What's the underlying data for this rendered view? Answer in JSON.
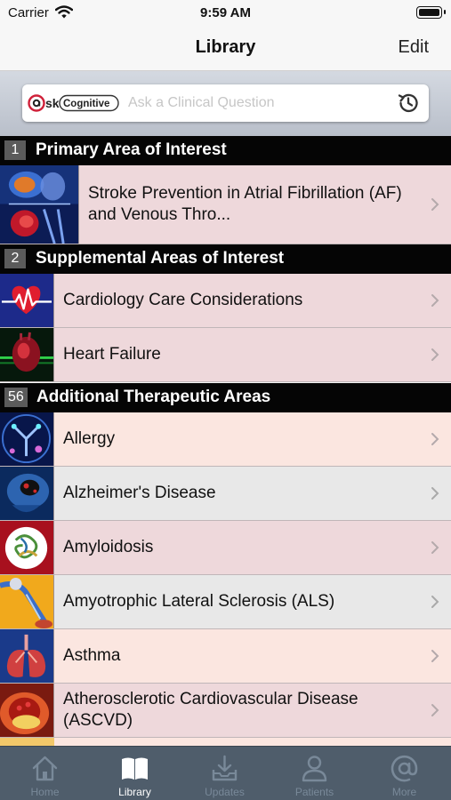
{
  "status_bar": {
    "carrier": "Carrier",
    "time": "9:59 AM"
  },
  "nav": {
    "title": "Library",
    "edit_label": "Edit"
  },
  "search": {
    "logo_text": "ask Cognitive",
    "placeholder": "Ask a Clinical Question",
    "value": ""
  },
  "sections": {
    "primary": {
      "count": "1",
      "title": "Primary Area of Interest",
      "items": [
        {
          "label": "Stroke Prevention in Atrial Fibrillation (AF) and Venous Thro...",
          "thumb": "brain-heart-image"
        }
      ]
    },
    "supplemental": {
      "count": "2",
      "title": "Supplemental Areas of Interest",
      "items": [
        {
          "label": "Cardiology Care Considerations",
          "thumb": "heartbeat-image"
        },
        {
          "label": "Heart Failure",
          "thumb": "heart-image"
        }
      ]
    },
    "additional": {
      "count": "56",
      "title": "Additional Therapeutic Areas",
      "items": [
        {
          "label": "Allergy",
          "thumb": "allergy-image"
        },
        {
          "label": "Alzheimer's Disease",
          "thumb": "brain-scan-image"
        },
        {
          "label": "Amyloidosis",
          "thumb": "protein-image"
        },
        {
          "label": "Amyotrophic Lateral Sclerosis (ALS)",
          "thumb": "neuron-image"
        },
        {
          "label": "Asthma",
          "thumb": "lungs-image"
        },
        {
          "label": "Atherosclerotic Cardiovascular Disease (ASCVD)",
          "thumb": "artery-image"
        }
      ]
    }
  },
  "tabs": [
    {
      "label": "Home",
      "icon": "home-icon",
      "active": false
    },
    {
      "label": "Library",
      "icon": "library-icon",
      "active": true
    },
    {
      "label": "Updates",
      "icon": "updates-icon",
      "active": false
    },
    {
      "label": "Patients",
      "icon": "patients-icon",
      "active": false
    },
    {
      "label": "More",
      "icon": "more-icon",
      "active": false
    }
  ],
  "colors": {
    "section_header_bg": "#050505",
    "row_pink": "#eed8db",
    "row_grey": "#e8e8e8",
    "row_peach": "#fbe6e0",
    "tab_bar_bg": "#4f5d6b",
    "tab_active": "#ffffff",
    "tab_inactive": "#798999"
  }
}
